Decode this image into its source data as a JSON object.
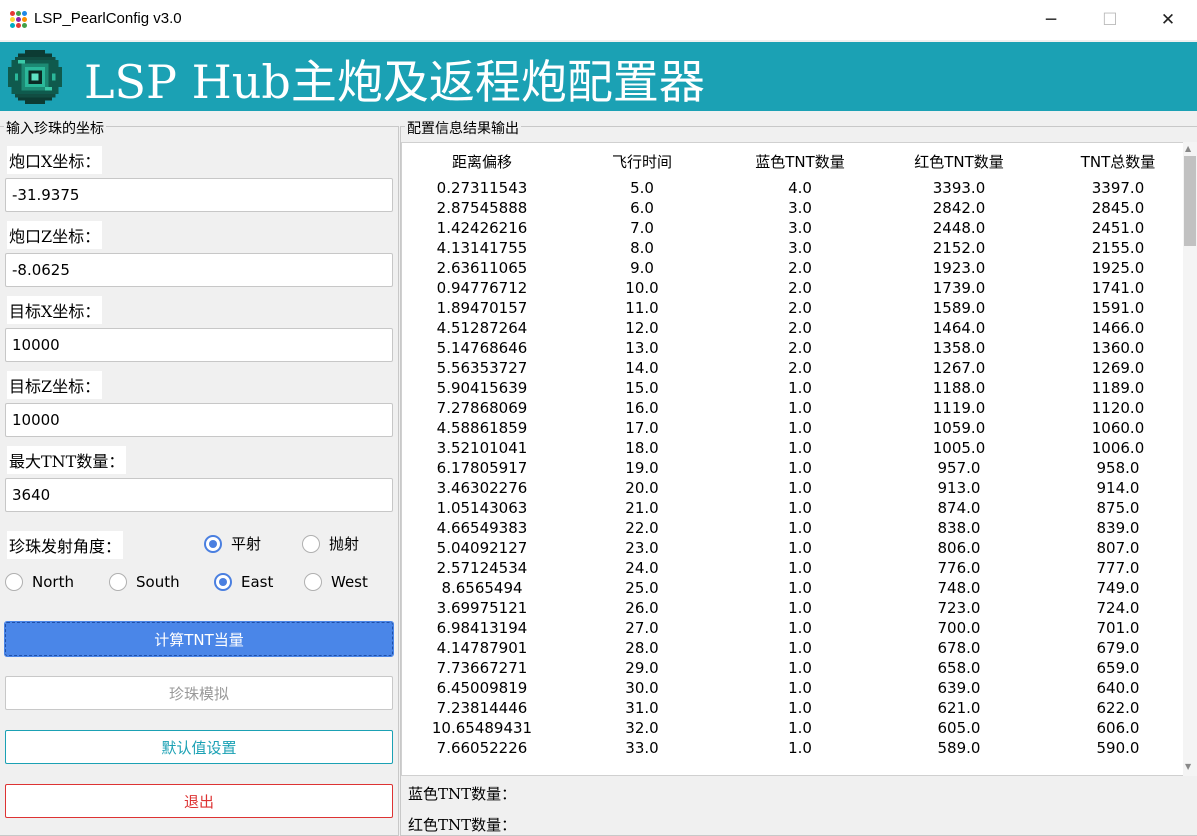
{
  "window": {
    "title": "LSP_PearlConfig v3.0",
    "minimize_glyph": "─",
    "maximize_glyph": "☐",
    "close_glyph": "✕"
  },
  "banner": {
    "title": "LSP Hub主炮及返程炮配置器",
    "color": "#1ba1b4"
  },
  "input_group": {
    "caption": "输入珍珠的坐标",
    "cannon_x_label": "炮口X坐标：",
    "cannon_x_value": "-31.9375",
    "cannon_z_label": "炮口Z坐标：",
    "cannon_z_value": "-8.0625",
    "target_x_label": "目标X坐标：",
    "target_x_value": "10000",
    "target_z_label": "目标Z坐标：",
    "target_z_value": "10000",
    "max_tnt_label": "最大TNT数量：",
    "max_tnt_value": "3640",
    "angle_label": "珍珠发射角度：",
    "angle_options": [
      {
        "label": "平射",
        "checked": true
      },
      {
        "label": "抛射",
        "checked": false
      }
    ],
    "direction_options": [
      {
        "label": "North",
        "checked": false
      },
      {
        "label": "South",
        "checked": false
      },
      {
        "label": "East",
        "checked": true
      },
      {
        "label": "West",
        "checked": false
      }
    ]
  },
  "buttons": {
    "calc": "计算TNT当量",
    "simulate": "珍珠模拟",
    "defaults": "默认值设置",
    "exit": "退出"
  },
  "output_group": {
    "caption": "配置信息结果输出",
    "columns": [
      "距离偏移",
      "飞行时间",
      "蓝色TNT数量",
      "红色TNT数量",
      "TNT总数量"
    ],
    "rows": [
      [
        "0.27311543",
        "5.0",
        "4.0",
        "3393.0",
        "3397.0"
      ],
      [
        "2.87545888",
        "6.0",
        "3.0",
        "2842.0",
        "2845.0"
      ],
      [
        "1.42426216",
        "7.0",
        "3.0",
        "2448.0",
        "2451.0"
      ],
      [
        "4.13141755",
        "8.0",
        "3.0",
        "2152.0",
        "2155.0"
      ],
      [
        "2.63611065",
        "9.0",
        "2.0",
        "1923.0",
        "1925.0"
      ],
      [
        "0.94776712",
        "10.0",
        "2.0",
        "1739.0",
        "1741.0"
      ],
      [
        "1.89470157",
        "11.0",
        "2.0",
        "1589.0",
        "1591.0"
      ],
      [
        "4.51287264",
        "12.0",
        "2.0",
        "1464.0",
        "1466.0"
      ],
      [
        "5.14768646",
        "13.0",
        "2.0",
        "1358.0",
        "1360.0"
      ],
      [
        "5.56353727",
        "14.0",
        "2.0",
        "1267.0",
        "1269.0"
      ],
      [
        "5.90415639",
        "15.0",
        "1.0",
        "1188.0",
        "1189.0"
      ],
      [
        "7.27868069",
        "16.0",
        "1.0",
        "1119.0",
        "1120.0"
      ],
      [
        "4.58861859",
        "17.0",
        "1.0",
        "1059.0",
        "1060.0"
      ],
      [
        "3.52101041",
        "18.0",
        "1.0",
        "1005.0",
        "1006.0"
      ],
      [
        "6.17805917",
        "19.0",
        "1.0",
        "957.0",
        "958.0"
      ],
      [
        "3.46302276",
        "20.0",
        "1.0",
        "913.0",
        "914.0"
      ],
      [
        "1.05143063",
        "21.0",
        "1.0",
        "874.0",
        "875.0"
      ],
      [
        "4.66549383",
        "22.0",
        "1.0",
        "838.0",
        "839.0"
      ],
      [
        "5.04092127",
        "23.0",
        "1.0",
        "806.0",
        "807.0"
      ],
      [
        "2.57124534",
        "24.0",
        "1.0",
        "776.0",
        "777.0"
      ],
      [
        "8.6565494",
        "25.0",
        "1.0",
        "748.0",
        "749.0"
      ],
      [
        "3.69975121",
        "26.0",
        "1.0",
        "723.0",
        "724.0"
      ],
      [
        "6.98413194",
        "27.0",
        "1.0",
        "700.0",
        "701.0"
      ],
      [
        "4.14787901",
        "28.0",
        "1.0",
        "678.0",
        "679.0"
      ],
      [
        "7.73667271",
        "29.0",
        "1.0",
        "658.0",
        "659.0"
      ],
      [
        "6.45009819",
        "30.0",
        "1.0",
        "639.0",
        "640.0"
      ],
      [
        "7.23814446",
        "31.0",
        "1.0",
        "621.0",
        "622.0"
      ],
      [
        "10.65489431",
        "32.0",
        "1.0",
        "605.0",
        "606.0"
      ],
      [
        "7.66052226",
        "33.0",
        "1.0",
        "589.0",
        "590.0"
      ]
    ],
    "blue_tnt_label": "蓝色TNT数量：",
    "red_tnt_label": "红色TNT数量："
  }
}
